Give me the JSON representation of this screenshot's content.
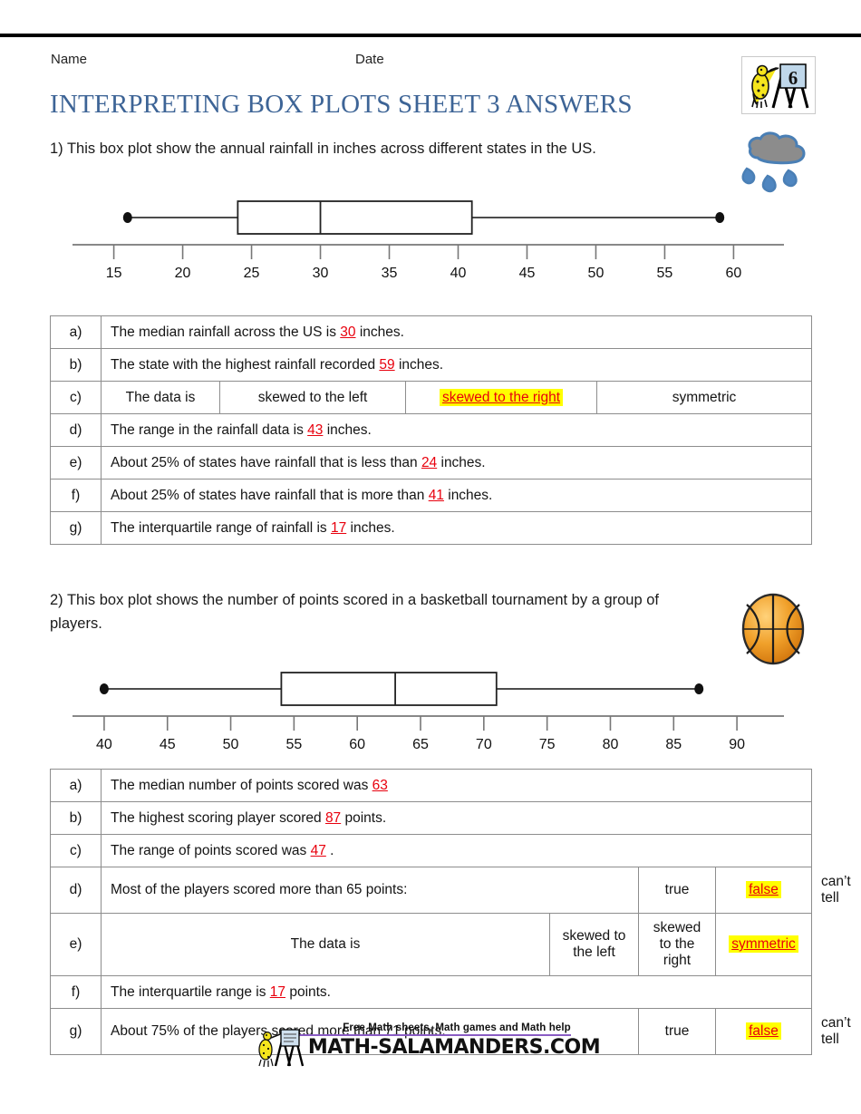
{
  "header": {
    "name_label": "Name",
    "date_label": "Date",
    "title": "INTERPRETING BOX PLOTS SHEET 3 ANSWERS",
    "logo_level": "6",
    "title_color": "#3d6496"
  },
  "questions": [
    {
      "prompt": "1) This box plot show the annual rainfall in inches across different states in the US.",
      "clipart": "rain-cloud-icon"
    },
    {
      "prompt": "2) This box plot shows the number of points scored in a basketball tournament by a group of players.",
      "clipart": "basketball-icon"
    }
  ],
  "chart_data": [
    {
      "type": "boxplot",
      "title": "Annual rainfall in inches across different states in the US",
      "xlabel": "",
      "ticks": [
        15,
        20,
        25,
        30,
        35,
        40,
        45,
        50,
        55,
        60
      ],
      "xlim": [
        12,
        63
      ],
      "min": 16,
      "q1": 24,
      "median": 30,
      "q3": 41,
      "max": 59,
      "iqr": 17,
      "range": 43,
      "grid": false
    },
    {
      "type": "boxplot",
      "title": "Number of points scored in a basketball tournament by a group of players",
      "xlabel": "",
      "ticks": [
        40,
        45,
        50,
        55,
        60,
        65,
        70,
        75,
        80,
        85,
        90
      ],
      "xlim": [
        37.5,
        93
      ],
      "min": 40,
      "q1": 54,
      "median": 63,
      "q3": 71,
      "max": 87,
      "iqr": 17,
      "range": 47,
      "grid": false
    }
  ],
  "table1": {
    "rows": [
      {
        "label": "a)",
        "kind": "sentence",
        "pre": "The median rainfall across the US is ",
        "answer": "30",
        "post": " inches."
      },
      {
        "label": "b)",
        "kind": "sentence",
        "pre": "The state with the highest rainfall recorded ",
        "answer": "59",
        "post": " inches."
      },
      {
        "label": "c)",
        "kind": "choice",
        "stem": "The data is",
        "options": [
          "skewed to the left",
          "skewed to the right",
          "symmetric"
        ],
        "selected": "skewed to the right"
      },
      {
        "label": "d)",
        "kind": "sentence",
        "pre": "The range in the rainfall data is ",
        "answer": "43",
        "post": " inches."
      },
      {
        "label": "e)",
        "kind": "sentence",
        "pre": "About 25% of states have rainfall that is less than ",
        "answer": "24",
        "post": " inches."
      },
      {
        "label": "f)",
        "kind": "sentence",
        "pre": "About 25% of states have rainfall that is more than ",
        "answer": "41",
        "post": " inches."
      },
      {
        "label": "g)",
        "kind": "sentence",
        "pre": "The interquartile range of rainfall is ",
        "answer": "17",
        "post": " inches."
      }
    ]
  },
  "table2": {
    "rows": [
      {
        "label": "a)",
        "kind": "sentence",
        "pre": "The median number of points scored was ",
        "answer": "63",
        "post": ""
      },
      {
        "label": "b)",
        "kind": "sentence",
        "pre": "The highest scoring player scored ",
        "answer": "87",
        "post": " points."
      },
      {
        "label": "c)",
        "kind": "sentence",
        "pre": "The range of points scored was ",
        "answer": "47",
        "post": " ."
      },
      {
        "label": "d)",
        "kind": "truefalse",
        "stem": "Most of the players scored more than 65 points:",
        "options": [
          "true",
          "false",
          "can’t tell"
        ],
        "selected": "false"
      },
      {
        "label": "e)",
        "kind": "choice",
        "stem": "The data is",
        "options": [
          "skewed to the left",
          "skewed to the right",
          "symmetric"
        ],
        "selected": "symmetric"
      },
      {
        "label": "f)",
        "kind": "sentence",
        "pre": "The interquartile range is ",
        "answer": "17",
        "post": " points."
      },
      {
        "label": "g)",
        "kind": "truefalse",
        "stem": "About 75% of the players scored more than 71 points.",
        "options": [
          "true",
          "false",
          "can’t tell"
        ],
        "selected": "false"
      }
    ]
  },
  "footer": {
    "tagline": "Free Math sheets, Math games and Math help",
    "domain": "MATH-SALAMANDERS.COM",
    "rule_color": "#8a5cc4"
  }
}
